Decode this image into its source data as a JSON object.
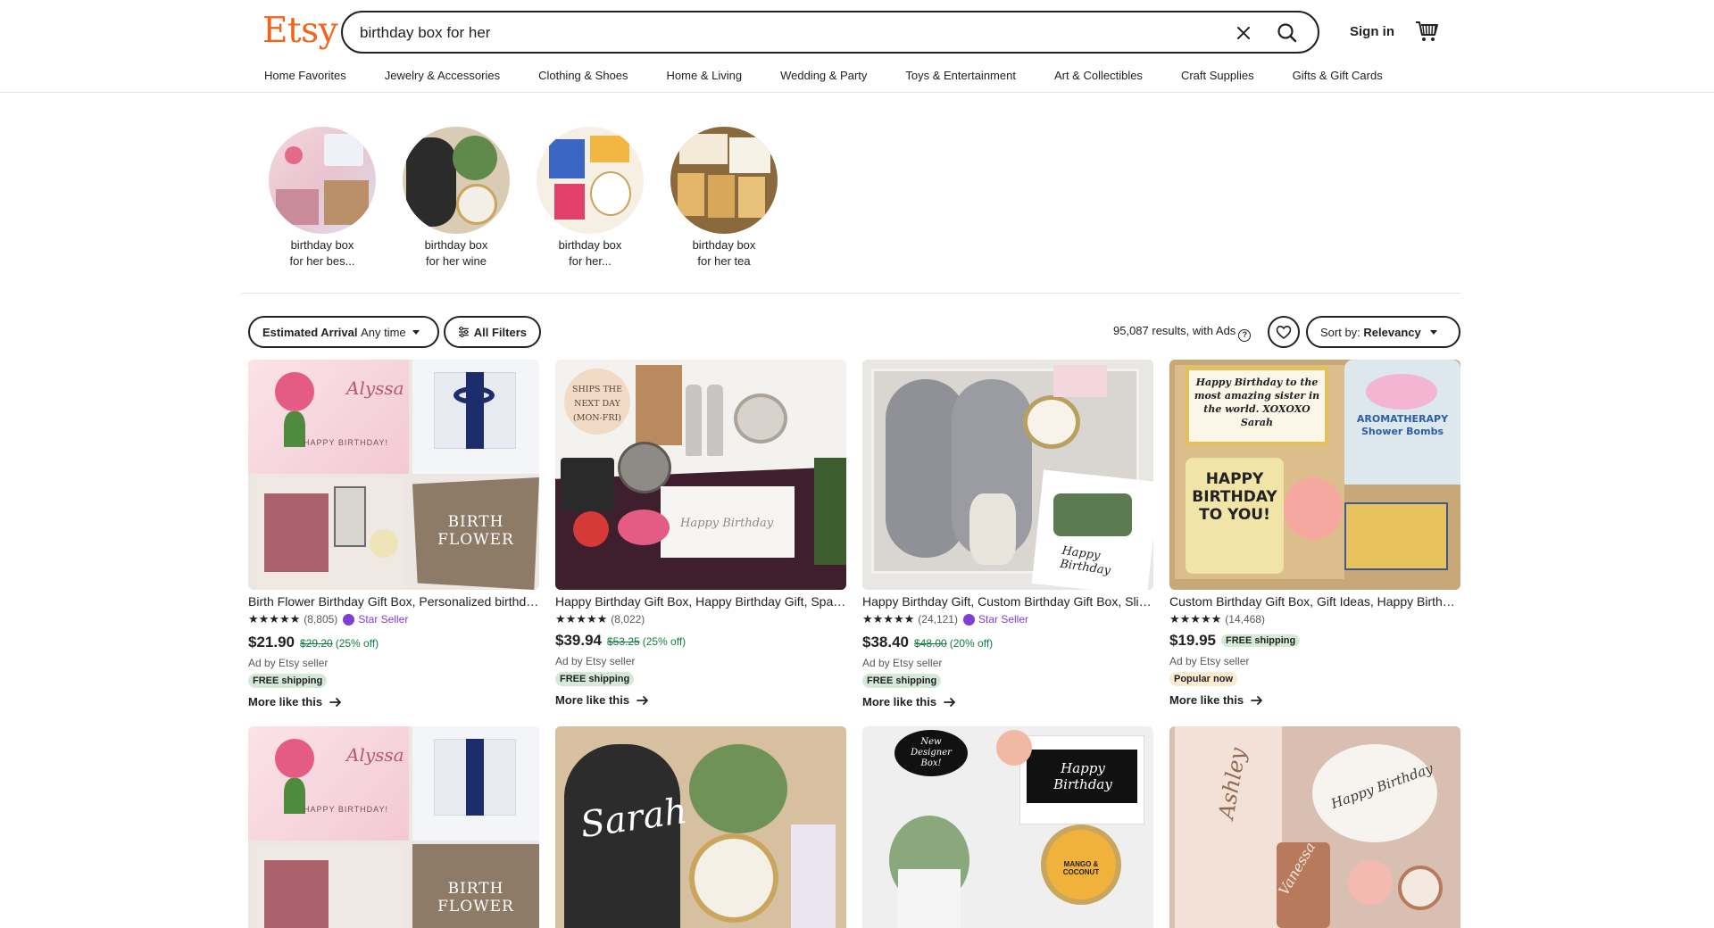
{
  "header": {
    "logo": "Etsy",
    "search_value": "birthday box for her",
    "sign_in": "Sign in"
  },
  "categories": [
    "Home Favorites",
    "Jewelry & Accessories",
    "Clothing & Shoes",
    "Home & Living",
    "Wedding & Party",
    "Toys & Entertainment",
    "Art & Collectibles",
    "Craft Supplies",
    "Gifts & Gift Cards"
  ],
  "related": [
    {
      "line1": "birthday box",
      "line2": "for her bes..."
    },
    {
      "line1": "birthday box",
      "line2": "for her wine"
    },
    {
      "line1": "birthday box",
      "line2": "for her..."
    },
    {
      "line1": "birthday box",
      "line2": "for her tea"
    }
  ],
  "filters": {
    "arrival_label": "Estimated Arrival",
    "arrival_value": "Any time",
    "all_filters": "All Filters",
    "results": "95,087 results, with Ads",
    "sort_label": "Sort by:",
    "sort_value": "Relevancy"
  },
  "listings": [
    {
      "title": "Birth Flower Birthday Gift Box, Personalized birthday gift for her",
      "stars": "★★★★★",
      "reviews": "(8,805)",
      "star_seller": "Star Seller",
      "price": "$21.90",
      "orig": "$29.20",
      "disc": "(25% off)",
      "ad": "Ad by Etsy seller",
      "tag": "FREE shipping",
      "more": "More like this"
    },
    {
      "title": "Happy Birthday Gift Box, Happy Birthday Gift, Spa Gift Box",
      "stars": "★★★★★",
      "reviews": "(8,022)",
      "price": "$39.94",
      "orig": "$53.25",
      "disc": "(25% off)",
      "ad": "Ad by Etsy seller",
      "tag": "FREE shipping",
      "more": "More like this"
    },
    {
      "title": "Happy Birthday Gift, Custom Birthday Gift Box, Slippers Gift",
      "stars": "★★★★★",
      "reviews": "(24,121)",
      "star_seller": "Star Seller",
      "price": "$38.40",
      "orig": "$48.00",
      "disc": "(20% off)",
      "ad": "Ad by Etsy seller",
      "tag": "FREE shipping",
      "more": "More like this"
    },
    {
      "title": "Custom Birthday Gift Box, Gift Ideas, Happy Birthday Candle",
      "stars": "★★★★★",
      "reviews": "(14,468)",
      "price": "$19.95",
      "free_inline": "FREE shipping",
      "ad": "Ad by Etsy seller",
      "tag": "Popular now",
      "more": "More like this"
    }
  ],
  "image_text": {
    "alyssa": "Alyssa",
    "happy_birthday_xoxo": "HAPPY BIRTHDAY!",
    "birth": "BIRTH",
    "flower": "FLOWER",
    "ships": "SHIPS THE NEXT DAY (MON-FRI)",
    "happy_birthday_script": "Happy Birthday",
    "card4_note": "Happy Birthday to the most amazing sister in the world. XOXOXO Sarah",
    "card4_candle": "HAPPY BIRTHDAY TO YOU!",
    "aromatherapy": "AROMATHERAPY Shower Bombs",
    "sarah": "Sarah",
    "new_designer": "New Designer Box!",
    "mango": "MANGO & COCONUT",
    "ashley": "Ashley",
    "vanessa": "Vanessa"
  },
  "colors": {
    "brand": "#f1641e",
    "star_seller": "#7f3fd1",
    "discount": "#0e7e3d",
    "free_bg": "#d4e9d7"
  }
}
